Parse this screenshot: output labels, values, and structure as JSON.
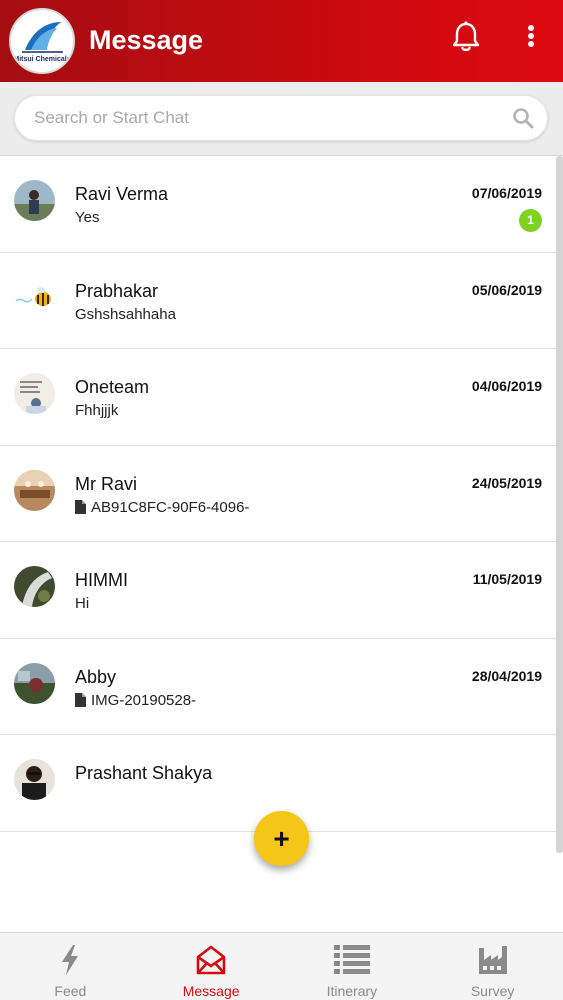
{
  "header": {
    "title": "Message",
    "logo_text": "Mitsui Chemicals",
    "brand_color": "#d20d12"
  },
  "search": {
    "placeholder": "Search or Start Chat"
  },
  "chats": [
    {
      "name": "Ravi Verma",
      "preview": "Yes",
      "date": "07/06/2019",
      "unread": "1",
      "attachment": false
    },
    {
      "name": "Prabhakar",
      "preview": "Gshshsahhaha",
      "date": "05/06/2019",
      "unread": null,
      "attachment": false
    },
    {
      "name": "Oneteam",
      "preview": "Fhhjjjk",
      "date": "04/06/2019",
      "unread": null,
      "attachment": false
    },
    {
      "name": "Mr Ravi",
      "preview": "AB91C8FC-90F6-4096-",
      "date": "24/05/2019",
      "unread": null,
      "attachment": true
    },
    {
      "name": "HIMMI",
      "preview": "Hi",
      "date": "11/05/2019",
      "unread": null,
      "attachment": false
    },
    {
      "name": "Abby",
      "preview": "IMG-20190528-",
      "date": "28/04/2019",
      "unread": null,
      "attachment": true
    },
    {
      "name": "Prashant Shakya",
      "preview": "",
      "date": "",
      "unread": null,
      "attachment": false
    }
  ],
  "fab": {
    "label": "+"
  },
  "tabs": [
    {
      "label": "Feed",
      "icon": "bolt-icon",
      "active": false
    },
    {
      "label": "Message",
      "icon": "envelope-icon",
      "active": true
    },
    {
      "label": "Itinerary",
      "icon": "list-icon",
      "active": false
    },
    {
      "label": "Survey",
      "icon": "factory-icon",
      "active": false
    }
  ],
  "colors": {
    "unread_badge": "#7ed321",
    "fab": "#f5c518",
    "tab_inactive": "#8a8a8a"
  }
}
